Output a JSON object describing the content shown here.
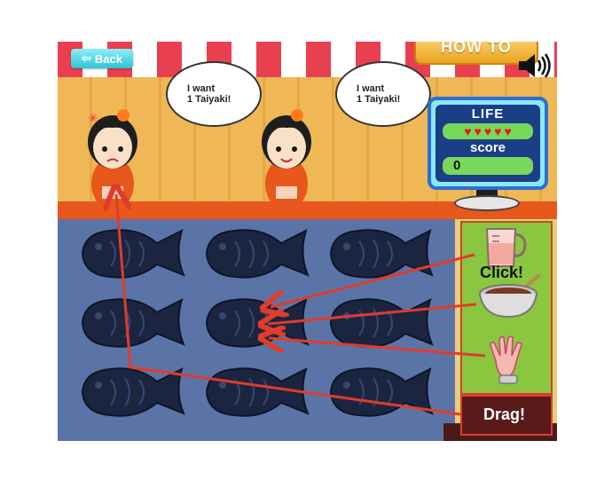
{
  "header": {
    "back_label": "Back",
    "howto_label": "HOW TO"
  },
  "customers": [
    {
      "line1": "I want",
      "line2": "1 Taiyaki!",
      "mood": "angry"
    },
    {
      "line1": "I want",
      "line2": "1 Taiyaki!",
      "mood": "happy"
    }
  ],
  "status": {
    "life_label": "LIFE",
    "lives": 5,
    "score_label": "score",
    "score": "0"
  },
  "tutorial": {
    "click_label": "Click!",
    "drag_label": "Drag!"
  },
  "tools": [
    "batter-pitcher-icon",
    "red-bean-paste-bowl-icon",
    "glove-icon"
  ],
  "grid": {
    "rows": 3,
    "cols": 3
  },
  "colors": {
    "awning_red": "#e8404f",
    "board": "#5b74a8",
    "mold": "#1c2540",
    "tray": "#8ac63f",
    "arrow": "#e03c2c",
    "monitor_frame": "#2a6fd2"
  }
}
